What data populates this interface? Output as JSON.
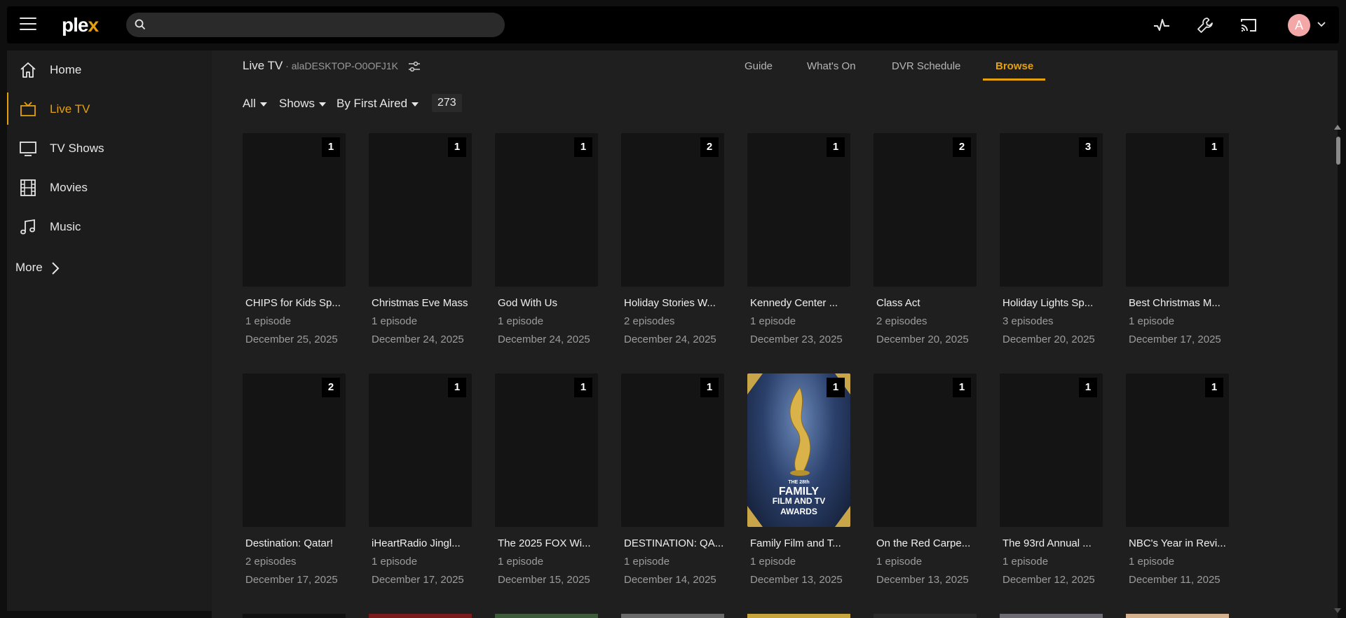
{
  "header": {
    "logo_text": "ple",
    "logo_accent": "x",
    "search_placeholder": "",
    "avatar_initial": "A",
    "icons": [
      "menu-icon",
      "search-icon",
      "activity-icon",
      "wrench-icon",
      "cast-icon",
      "avatar",
      "chevron-down-icon"
    ]
  },
  "sidebar": {
    "items": [
      {
        "label": "Home",
        "icon": "home-icon"
      },
      {
        "label": "Live TV",
        "icon": "tv-icon",
        "active": true
      },
      {
        "label": "TV Shows",
        "icon": "monitor-icon"
      },
      {
        "label": "Movies",
        "icon": "film-icon"
      },
      {
        "label": "Music",
        "icon": "music-note-icon"
      }
    ],
    "more_label": "More"
  },
  "main": {
    "title": "Live TV",
    "subtitle": " · alaDESKTOP-O0OFJ1K",
    "tabs": [
      {
        "label": "Guide"
      },
      {
        "label": "What's On"
      },
      {
        "label": "DVR Schedule"
      },
      {
        "label": "Browse",
        "active": true
      }
    ],
    "filters": {
      "all": "All",
      "type": "Shows",
      "sort": "By First Aired",
      "count": "273"
    },
    "row1": [
      {
        "title": "CHIPS for Kids Sp...",
        "episodes": "1 episode",
        "date": "December 25, 2025",
        "badge": "1"
      },
      {
        "title": "Christmas Eve Mass",
        "episodes": "1 episode",
        "date": "December 24, 2025",
        "badge": "1"
      },
      {
        "title": "God With Us",
        "episodes": "1 episode",
        "date": "December 24, 2025",
        "badge": "1"
      },
      {
        "title": "Holiday Stories W...",
        "episodes": "2 episodes",
        "date": "December 24, 2025",
        "badge": "2"
      },
      {
        "title": "Kennedy Center ...",
        "episodes": "1 episode",
        "date": "December 23, 2025",
        "badge": "1"
      },
      {
        "title": "Class Act",
        "episodes": "2 episodes",
        "date": "December 20, 2025",
        "badge": "2"
      },
      {
        "title": "Holiday Lights Sp...",
        "episodes": "3 episodes",
        "date": "December 20, 2025",
        "badge": "3"
      },
      {
        "title": "Best Christmas M...",
        "episodes": "1 episode",
        "date": "December 17, 2025",
        "badge": "1"
      }
    ],
    "row2": [
      {
        "title": "Destination: Qatar!",
        "episodes": "2 episodes",
        "date": "December 17, 2025",
        "badge": "2"
      },
      {
        "title": "iHeartRadio Jingl...",
        "episodes": "1 episode",
        "date": "December 17, 2025",
        "badge": "1"
      },
      {
        "title": "The 2025 FOX Wi...",
        "episodes": "1 episode",
        "date": "December 15, 2025",
        "badge": "1"
      },
      {
        "title": "DESTINATION: QA...",
        "episodes": "1 episode",
        "date": "December 14, 2025",
        "badge": "1"
      },
      {
        "title": "Family Film and T...",
        "episodes": "1 episode",
        "date": "December 13, 2025",
        "badge": "1",
        "poster_lines": [
          "THE 28th",
          "FAMILY",
          "FILM AND TV",
          "AWARDS"
        ]
      },
      {
        "title": "On the Red Carpe...",
        "episodes": "1 episode",
        "date": "December 13, 2025",
        "badge": "1"
      },
      {
        "title": "The 93rd Annual ...",
        "episodes": "1 episode",
        "date": "December 12, 2025",
        "badge": "1"
      },
      {
        "title": "NBC's Year in Revi...",
        "episodes": "1 episode",
        "date": "December 11, 2025",
        "badge": "1"
      }
    ],
    "peek_colors": [
      "#111111",
      "#7a1b1b",
      "#3d5a3a",
      "#6a6a6a",
      "#c7a43b",
      "#2a2a2a",
      "#6d6a72",
      "#d4b08c"
    ]
  },
  "colors": {
    "accent": "#e5a00d",
    "background": "#1f1f1f",
    "sidebar": "#1c1c1c",
    "topbar": "#000000"
  }
}
